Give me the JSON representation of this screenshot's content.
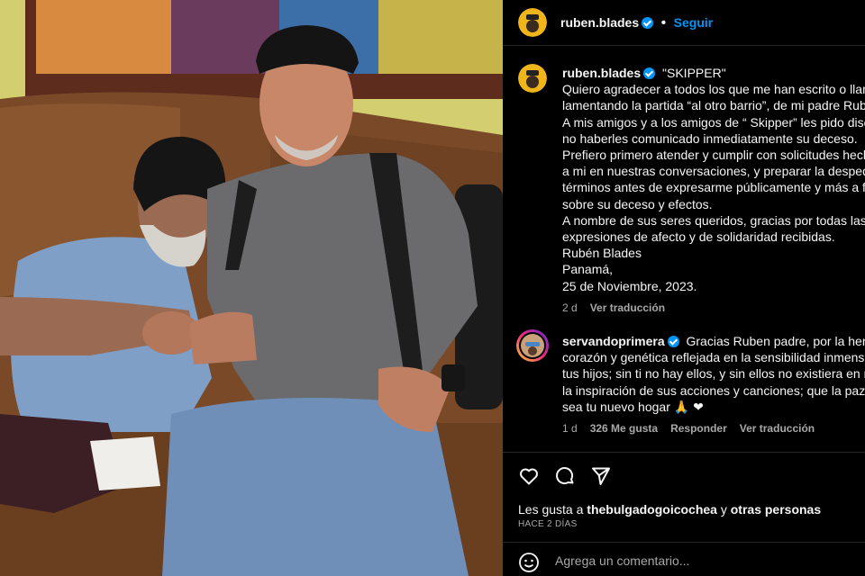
{
  "post": {
    "username": "ruben.blades",
    "follow_label": "Seguir",
    "caption_title": "\"SKIPPER\"",
    "caption_lines": [
      "Quiero agradecer a todos los que me han escrito o llam",
      "lamentando la partida “al otro barrio”, de mi padre Rub",
      "A mis amigos y a los amigos de “ Skipper” les pido disc",
      "no haberles comunicado inmediatamente su deceso.",
      "Prefiero primero atender y cumplir con solicitudes hech",
      "a mi en nuestras conversaciones, y preparar la despedi",
      "términos antes de expresarme públicamente y más a fo",
      "sobre su deceso y efectos.",
      "A nombre de sus seres queridos, gracias por todas las",
      "expresiones de afecto y de solidaridad recibidas.",
      "Rubén Blades",
      "Panamá,",
      "25 de Noviembre, 2023."
    ],
    "caption_age": "2 d",
    "caption_translate": "Ver traducción"
  },
  "comment": {
    "username": "servandoprimera",
    "lines": [
      "Gracias Ruben padre, por la heren",
      "corazón y genética reflejada en la sensibilidad inmensu",
      "tus hijos; sin ti no hay ellos, y sin ellos no existiera en n",
      "la inspiración de sus acciones y canciones; que la paz e",
      "sea tu nuevo hogar 🙏 ❤"
    ],
    "age": "1 d",
    "likes": "326 Me gusta",
    "reply": "Responder",
    "translate": "Ver traducción"
  },
  "actions": {
    "likes_prefix": "Les gusta a",
    "likes_user": "thebulgadogoicochea",
    "likes_join": "y",
    "likes_others": "otras personas",
    "date": "HACE 2 DÍAS"
  },
  "add_comment": {
    "placeholder": "Agrega un comentario..."
  },
  "icons": [
    "heart-icon",
    "comment-icon",
    "share-icon",
    "emoji-icon"
  ],
  "colors": {
    "accent": "#0095f6",
    "heart": "#e0245e"
  }
}
